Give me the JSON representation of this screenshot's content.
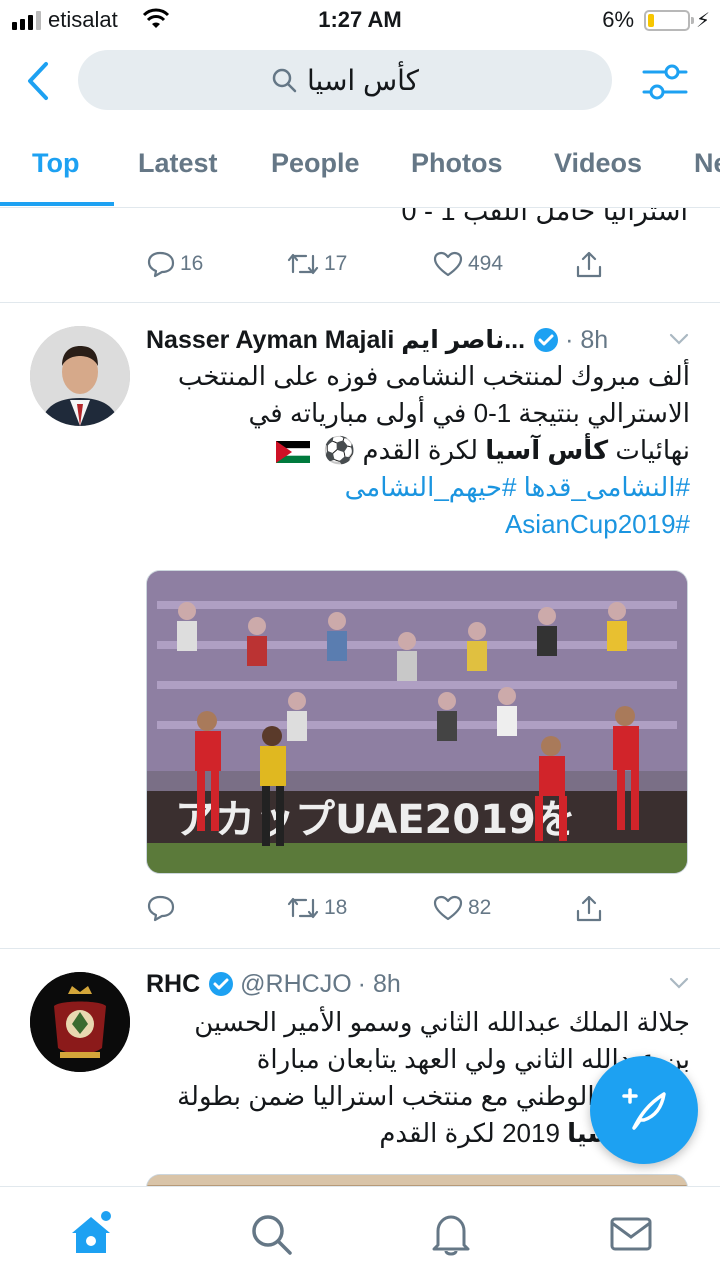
{
  "status_bar": {
    "carrier": "etisalat",
    "time": "1:27 AM",
    "battery": "6%"
  },
  "search": {
    "query": "كأس اسيا"
  },
  "tabs": [
    {
      "label": "Top",
      "active": true
    },
    {
      "label": "Latest"
    },
    {
      "label": "People"
    },
    {
      "label": "Photos"
    },
    {
      "label": "Videos"
    },
    {
      "label": "Ne"
    }
  ],
  "prev_tweet": {
    "partial_text": "استراليا حامل اللقب 1 - 0",
    "replies": "16",
    "retweets": "17",
    "likes": "494"
  },
  "tweet1": {
    "name": "Nasser Ayman Majali ناصر ايم...",
    "time": "· 8h",
    "text_line1": "ألف مبروك لمنتخب النشامى فوزه على المنتخب",
    "text_line2": "الاسترالي بنتيجة 1-0 في أولى مبارياته في",
    "text_line3_pre": "نهائيات ",
    "text_line3_hl": "كأس آسيا",
    "text_line3_post": " لكرة القدم ⚽",
    "hashtags_line1": "#النشامى_قدها #حيهم_النشامى",
    "hashtags_line2": "#AsianCup2019",
    "image_banner_text": "アカップUAE2019を",
    "replies": "",
    "retweets": "18",
    "likes": "82"
  },
  "tweet2": {
    "name": "RHC",
    "handle": "@RHCJO",
    "time": "· 8h",
    "line1": "جلالة الملك عبدالله الثاني وسمو الأمير الحسين",
    "line2": "بن عبدالله الثاني ولي العهد يتابعان مباراة",
    "line3": "المنتخب الوطني مع منتخب استراليا ضمن بطولة",
    "line4_hl": "كأس آسيا",
    "line4_post": " 2019 لكرة القدم"
  },
  "colors": {
    "accent": "#1da1f2",
    "text": "#14171a",
    "muted": "#657786"
  }
}
